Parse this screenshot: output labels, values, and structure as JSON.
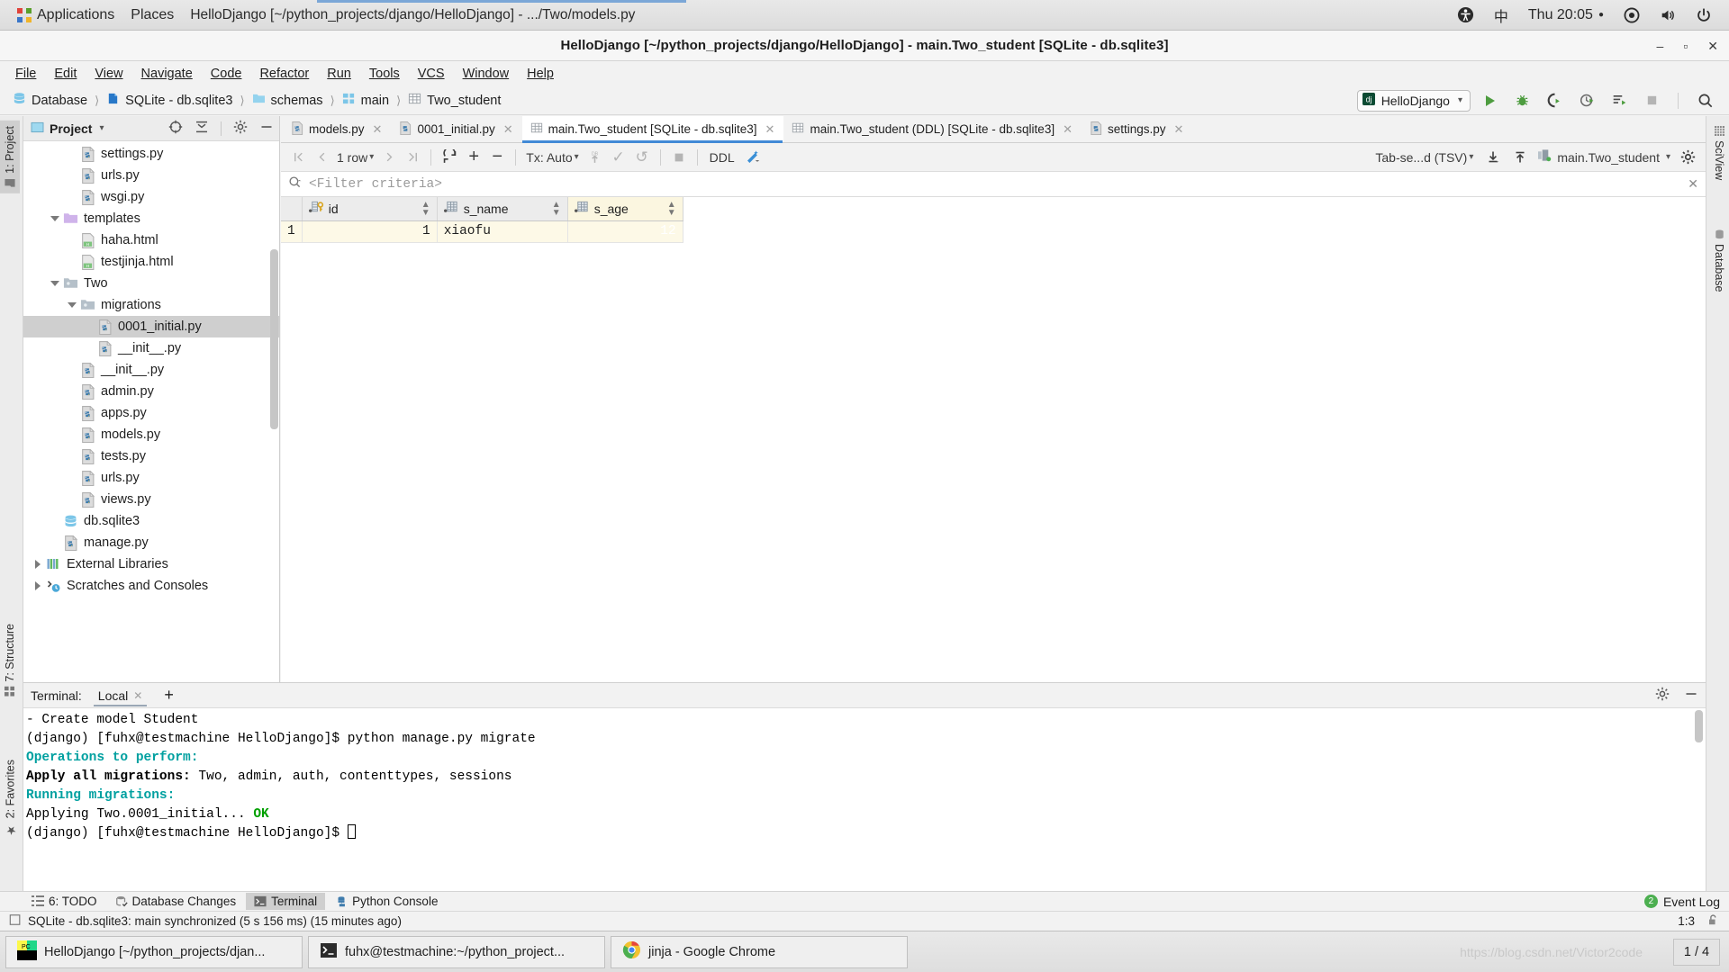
{
  "gnome_panel": {
    "applications": "Applications",
    "places": "Places",
    "window_title": "HelloDjango [~/python_projects/django/HelloDjango] - .../Two/models.py",
    "accessibility_icon": "accessibility-icon",
    "input_method": "中",
    "clock": "Thu 20:05",
    "network_icon": "network-icon",
    "volume_icon": "volume-icon",
    "power_icon": "power-icon"
  },
  "ide": {
    "title": "HelloDjango [~/python_projects/django/HelloDjango] - main.Two_student [SQLite - db.sqlite3]",
    "window_controls": {
      "minimize": "–",
      "maximize": "▫",
      "close": "✕"
    },
    "menubar": [
      {
        "label": "File",
        "mnemonic": "F"
      },
      {
        "label": "Edit",
        "mnemonic": "E"
      },
      {
        "label": "View",
        "mnemonic": "V"
      },
      {
        "label": "Navigate",
        "mnemonic": "N"
      },
      {
        "label": "Code",
        "mnemonic": "C"
      },
      {
        "label": "Refactor",
        "mnemonic": "R"
      },
      {
        "label": "Run",
        "mnemonic": "u"
      },
      {
        "label": "Tools",
        "mnemonic": "T"
      },
      {
        "label": "VCS",
        "mnemonic": "S"
      },
      {
        "label": "Window",
        "mnemonic": "W"
      },
      {
        "label": "Help",
        "mnemonic": "H"
      }
    ],
    "breadcrumbs": [
      {
        "label": "Database",
        "icon": "database-icon"
      },
      {
        "label": "SQLite - db.sqlite3",
        "icon": "sqlite-datasource-icon"
      },
      {
        "label": "schemas",
        "icon": "folder-icon"
      },
      {
        "label": "main",
        "icon": "schema-icon"
      },
      {
        "label": "Two_student",
        "icon": "table-icon"
      }
    ],
    "run_config": {
      "label": "HelloDjango",
      "icon": "django-icon"
    },
    "toolbar_buttons": [
      {
        "name": "run-button",
        "icon": "play-icon"
      },
      {
        "name": "debug-button",
        "icon": "bug-icon"
      },
      {
        "name": "run-with-coverage-button",
        "icon": "coverage-icon"
      },
      {
        "name": "profile-button",
        "icon": "profile-icon"
      },
      {
        "name": "run-dashboard-button",
        "icon": "run-list-icon"
      },
      {
        "name": "stop-button",
        "icon": "stop-icon"
      },
      {
        "name": "search-everywhere-button",
        "icon": "search-icon"
      }
    ]
  },
  "editor_tabs": [
    {
      "label": "models.py",
      "icon": "python-file-icon",
      "active": false
    },
    {
      "label": "0001_initial.py",
      "icon": "python-file-icon",
      "active": false
    },
    {
      "label": "main.Two_student [SQLite - db.sqlite3]",
      "icon": "table-icon",
      "active": true
    },
    {
      "label": "main.Two_student (DDL) [SQLite - db.sqlite3]",
      "icon": "table-icon",
      "active": false
    },
    {
      "label": "settings.py",
      "icon": "python-file-icon",
      "active": false
    }
  ],
  "left_strip": [
    {
      "label": "1: Project",
      "icon": "project-icon",
      "selected": true
    },
    {
      "label": "7: Structure",
      "icon": "structure-icon",
      "selected": false
    },
    {
      "label": "2: Favorites",
      "icon": "star-icon",
      "selected": false
    }
  ],
  "right_strip": [
    {
      "label": "SciView",
      "icon": "sciview-icon"
    },
    {
      "label": "Database",
      "icon": "database-icon"
    }
  ],
  "project_panel": {
    "title": "Project",
    "dropdown_icon": "chevron-down-icon",
    "tools": [
      {
        "name": "locate-button",
        "icon": "target-icon"
      },
      {
        "name": "collapse-all-button",
        "icon": "collapse-icon"
      },
      {
        "name": "settings-button",
        "icon": "gear-icon"
      },
      {
        "name": "hide-button",
        "icon": "minus-icon"
      }
    ],
    "tree": [
      {
        "label": "settings.py",
        "indent": 2,
        "icon": "python-file-icon",
        "twist": "none",
        "selected": false
      },
      {
        "label": "urls.py",
        "indent": 2,
        "icon": "python-file-icon",
        "twist": "none",
        "selected": false
      },
      {
        "label": "wsgi.py",
        "indent": 2,
        "icon": "python-file-icon",
        "twist": "none",
        "selected": false
      },
      {
        "label": "templates",
        "indent": 1,
        "icon": "folder-purple-icon",
        "twist": "open",
        "selected": false
      },
      {
        "label": "haha.html",
        "indent": 2,
        "icon": "html-file-icon",
        "twist": "none",
        "selected": false
      },
      {
        "label": "testjinja.html",
        "indent": 2,
        "icon": "html-file-icon",
        "twist": "none",
        "selected": false
      },
      {
        "label": "Two",
        "indent": 1,
        "icon": "folder-icon",
        "twist": "open",
        "selected": false
      },
      {
        "label": "migrations",
        "indent": 2,
        "icon": "folder-icon",
        "twist": "open",
        "selected": false
      },
      {
        "label": "0001_initial.py",
        "indent": 3,
        "icon": "python-file-icon",
        "twist": "none",
        "selected": true
      },
      {
        "label": "__init__.py",
        "indent": 3,
        "icon": "python-file-icon",
        "twist": "none",
        "selected": false
      },
      {
        "label": "__init__.py",
        "indent": 2,
        "icon": "python-file-icon",
        "twist": "none",
        "selected": false
      },
      {
        "label": "admin.py",
        "indent": 2,
        "icon": "python-file-icon",
        "twist": "none",
        "selected": false
      },
      {
        "label": "apps.py",
        "indent": 2,
        "icon": "python-file-icon",
        "twist": "none",
        "selected": false
      },
      {
        "label": "models.py",
        "indent": 2,
        "icon": "python-file-icon",
        "twist": "none",
        "selected": false
      },
      {
        "label": "tests.py",
        "indent": 2,
        "icon": "python-file-icon",
        "twist": "none",
        "selected": false
      },
      {
        "label": "urls.py",
        "indent": 2,
        "icon": "python-file-icon",
        "twist": "none",
        "selected": false
      },
      {
        "label": "views.py",
        "indent": 2,
        "icon": "python-file-icon",
        "twist": "none",
        "selected": false
      },
      {
        "label": "db.sqlite3",
        "indent": 1,
        "icon": "database-icon",
        "twist": "none",
        "selected": false
      },
      {
        "label": "manage.py",
        "indent": 1,
        "icon": "python-file-icon",
        "twist": "none",
        "selected": false
      },
      {
        "label": "External Libraries",
        "indent": 0,
        "icon": "libraries-icon",
        "twist": "closed",
        "selected": false
      },
      {
        "label": "Scratches and Consoles",
        "indent": 0,
        "icon": "scratches-icon",
        "twist": "closed",
        "selected": false
      }
    ]
  },
  "datagrid": {
    "toolbar": {
      "first_row": "❘⟨",
      "prev_row": "⟨",
      "row_count": "1 row",
      "next_row": "⟩",
      "last_row": "⟩❘",
      "reload": "reload-icon",
      "add_row": "+",
      "delete_row": "−",
      "tx_mode": "Tx: Auto",
      "submit_db": "submit-icon",
      "commit": "✓",
      "rollback": "↺",
      "cancel": "stop-icon",
      "ddl": "DDL",
      "modify_icon": "magic-wand-icon",
      "output_format": "Tab-se...d (TSV)",
      "import_icon": "import-icon",
      "export_icon": "export-icon",
      "table_selector": "main.Two_student",
      "settings_icon": "gear-icon"
    },
    "filter": {
      "icon": "search-icon",
      "placeholder": "<Filter criteria>",
      "close_icon": "close-icon"
    },
    "columns": [
      {
        "name": "id",
        "icon": "key-column-icon",
        "highlighted": false
      },
      {
        "name": "s_name",
        "icon": "column-icon",
        "highlighted": false
      },
      {
        "name": "s_age",
        "icon": "column-icon",
        "highlighted": true
      }
    ],
    "rows": [
      {
        "num": "1",
        "id": "1",
        "s_name": "xiaofu",
        "s_age": "12"
      }
    ],
    "selected_cell": {
      "row": 0,
      "column": "s_age"
    }
  },
  "terminal": {
    "label": "Terminal:",
    "tabs": [
      {
        "label": "Local",
        "close_icon": "close-icon"
      }
    ],
    "add_icon": "+",
    "tools": [
      {
        "name": "terminal-settings-button",
        "icon": "gear-icon"
      },
      {
        "name": "terminal-hide-button",
        "icon": "minus-icon"
      }
    ],
    "lines": [
      {
        "segments": [
          {
            "t": "    - Create model Student",
            "s": "plain"
          }
        ]
      },
      {
        "segments": [
          {
            "t": "(django) [fuhx@testmachine HelloDjango]$ python manage.py migrate",
            "s": "plain"
          }
        ]
      },
      {
        "segments": [
          {
            "t": "Operations to perform:",
            "s": "cyanb"
          }
        ]
      },
      {
        "segments": [
          {
            "t": "  Apply all migrations:",
            "s": "boldk"
          },
          {
            "t": " Two, admin, auth, contenttypes, sessions",
            "s": "plain"
          }
        ]
      },
      {
        "segments": [
          {
            "t": "Running migrations:",
            "s": "cyanb"
          }
        ]
      },
      {
        "segments": [
          {
            "t": "  Applying Two.0001_initial... ",
            "s": "plain"
          },
          {
            "t": "OK",
            "s": "greenb"
          }
        ]
      },
      {
        "segments": [
          {
            "t": "(django) [fuhx@testmachine HelloDjango]$ ",
            "s": "plain"
          },
          {
            "t": "",
            "s": "cursor"
          }
        ]
      }
    ]
  },
  "toolwindow_bar": {
    "items": [
      {
        "label": "6: TODO",
        "icon": "todo-icon",
        "active": false
      },
      {
        "label": "Database Changes",
        "icon": "db-changes-icon",
        "active": false
      },
      {
        "label": "Terminal",
        "icon": "terminal-icon",
        "active": true
      },
      {
        "label": "Python Console",
        "icon": "python-icon",
        "active": false
      }
    ],
    "event_log": {
      "label": "Event Log",
      "count": "2"
    }
  },
  "statusbar": {
    "icon": "memory-icon",
    "message": "SQLite - db.sqlite3: main synchronized (5 s 156 ms) (15 minutes ago)",
    "caret_position": "1:3",
    "lock_icon": "unlocked-icon"
  },
  "taskbar": {
    "tasks": [
      {
        "label": "HelloDjango [~/python_projects/djan...",
        "icon": "pycharm-icon"
      },
      {
        "label": "fuhx@testmachine:~/python_project...",
        "icon": "terminal-icon"
      },
      {
        "label": "jinja - Google Chrome",
        "icon": "chrome-icon"
      }
    ],
    "watermark": "https://blog.csdn.net/Victor2code",
    "workspace": "1 / 4"
  },
  "colors": {
    "accent_blue": "#4189d6",
    "selection_blue": "#4b6ea9",
    "row_yellow": "#fdf9e7",
    "header_gray": "#ececec",
    "terminal_cyan": "#00a0a0",
    "terminal_green": "#00a000"
  }
}
